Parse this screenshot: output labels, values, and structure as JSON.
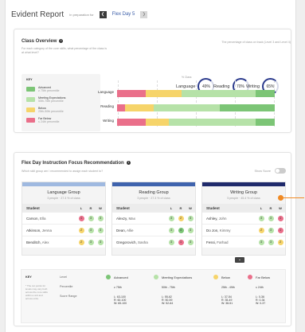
{
  "header": {
    "title": "Evident Report",
    "prep": "In preparation for",
    "day": "Flex Day 5"
  },
  "overview": {
    "title": "Class Overview",
    "subtitle": "For each category of the core skills, what percentage of the class is at what level?",
    "note": "The percentage of class on track (Level 3 and Level 4)",
    "gauges": [
      {
        "label": "Language",
        "value": "49%"
      },
      {
        "label": "Reading",
        "value": "70%"
      },
      {
        "label": "Writing",
        "value": "65%"
      }
    ],
    "key_title": "KEY",
    "key": [
      {
        "name": "Advanced",
        "range": "≥ 75th percentile",
        "color": "#7cc576"
      },
      {
        "name": "Meeting Expectations",
        "range": "50th-75th percentile",
        "color": "#b6e2a8"
      },
      {
        "name": "Below",
        "range": "25th-50th percentile",
        "color": "#f6d46a"
      },
      {
        "name": "Far Below",
        "range": "≤ 24th percentile",
        "color": "#ea6f8a"
      }
    ],
    "axis_top": "% Class",
    "axis_ticks": [
      "0",
      "25",
      "50",
      "75",
      "100"
    ],
    "rows": [
      {
        "label": "Language",
        "segments": [
          {
            "pct": 18,
            "color": "#ea6f8a"
          },
          {
            "pct": 23,
            "color": "#f6d46a"
          },
          {
            "pct": 47,
            "color": "#b6e2a8"
          },
          {
            "pct": 12,
            "color": "#7cc576"
          }
        ]
      },
      {
        "label": "Reading",
        "segments": [
          {
            "pct": 5,
            "color": "#ea6f8a"
          },
          {
            "pct": 18,
            "color": "#f6d46a"
          },
          {
            "pct": 42,
            "color": "#b6e2a8"
          },
          {
            "pct": 35,
            "color": "#7cc576"
          }
        ]
      },
      {
        "label": "Writing",
        "segments": [
          {
            "pct": 18,
            "color": "#ea6f8a"
          },
          {
            "pct": 15,
            "color": "#f6d46a"
          },
          {
            "pct": 55,
            "color": "#b6e2a8"
          },
          {
            "pct": 12,
            "color": "#7cc576"
          }
        ]
      }
    ]
  },
  "focus": {
    "title": "Flex Day Instruction Focus Recommendation",
    "subtitle": "Which skill group am I recommended to assign each student to?",
    "show_score": "Show Score",
    "groups": [
      {
        "title": "Language Group",
        "count": "3 people · 27.3 % of class",
        "color": "#9fb9e0",
        "rows": [
          {
            "name": "Carson",
            "last": "Ella",
            "d": [
              "#ea6f8a",
              "#b6e2a8",
              "#b6e2a8"
            ],
            "v": [
              "1",
              "3",
              "3"
            ]
          },
          {
            "name": "Atkinson",
            "last": "Jenna",
            "d": [
              "#f6d46a",
              "#b6e2a8",
              "#b6e2a8"
            ],
            "v": [
              "2",
              "3",
              "3"
            ]
          },
          {
            "name": "Benditch",
            "last": "Alex",
            "d": [
              "#f6d46a",
              "#b6e2a8",
              "#b6e2a8"
            ],
            "v": [
              "2",
              "3",
              "3"
            ]
          }
        ]
      },
      {
        "title": "Reading Group",
        "count": "3 people · 27.3 % of class",
        "color": "#3f63ad",
        "rows": [
          {
            "name": "Alexzy",
            "last": "Max",
            "d": [
              "#b6e2a8",
              "#f6d46a",
              "#b6e2a8"
            ],
            "v": [
              "3",
              "2",
              "3"
            ]
          },
          {
            "name": "Dean",
            "last": "Allie",
            "d": [
              "#b6e2a8",
              "#7cc576",
              "#b6e2a8"
            ],
            "v": [
              "3",
              "4",
              "3"
            ]
          },
          {
            "name": "Gregorovich",
            "last": "Sasha",
            "d": [
              "#b6e2a8",
              "#ea6f8a",
              "#b6e2a8"
            ],
            "v": [
              "3",
              "1",
              "3"
            ]
          }
        ]
      },
      {
        "title": "Writing Group",
        "count": "5 people · 45.4 % of class",
        "color": "#1f2a6b",
        "rows": [
          {
            "name": "Ashley",
            "last": "John",
            "d": [
              "#b6e2a8",
              "#b6e2a8",
              "#ea6f8a"
            ],
            "v": [
              "3",
              "3",
              "1"
            ]
          },
          {
            "name": "Do Jon",
            "last": "Kimmy",
            "d": [
              "#f6d46a",
              "#b6e2a8",
              "#ea6f8a"
            ],
            "v": [
              "2",
              "3",
              "1"
            ]
          },
          {
            "name": "Fessi",
            "last": "Farhad",
            "d": [
              "#b6e2a8",
              "#b6e2a8",
              "#f6d46a"
            ],
            "v": [
              "3",
              "3",
              "2"
            ]
          }
        ]
      }
    ],
    "cols": [
      "Student",
      "L",
      "R",
      "W"
    ],
    "key_title": "KEY",
    "key_note": "* The cut points for levels may vary both across the core skills within a unit and across units.",
    "key_rows": [
      "Level",
      "Percentile",
      "Score Range"
    ],
    "key_cols": [
      {
        "name": "Advanced",
        "color": "#7cc576",
        "pct": "≥ 75th",
        "range": "L: 63-100\nR: 60-100\nW: 65-100"
      },
      {
        "name": "Meeting Expectations",
        "color": "#b6e2a8",
        "pct": "50th - 75th",
        "range": "L: 55-62\nR: 50-59\nW: 52-64"
      },
      {
        "name": "Below",
        "color": "#f6d46a",
        "pct": "25th - 49th",
        "range": "L: 37-54\nR: 35-49\nW: 38-51"
      },
      {
        "name": "Far Below",
        "color": "#ea6f8a",
        "pct": "≤ 24th",
        "range": "L: 0-36\nR: 0-34\nW: 0-37"
      }
    ]
  }
}
